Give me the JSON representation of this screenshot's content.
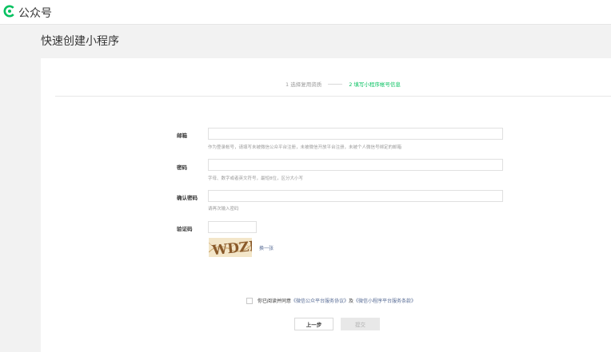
{
  "header": {
    "brand": "公众号",
    "brand_color": "#07c160"
  },
  "page": {
    "title": "快速创建小程序"
  },
  "steps": {
    "step1": "1 选择复用资质",
    "step2": "2 填写小程序帐号信息",
    "active_color": "#07c160"
  },
  "form": {
    "email": {
      "label": "邮箱",
      "value": "",
      "hint": "作为登录帐号，请填写未被微信公众平台注册，未被微信开放平台注册，未被个人微信号绑定的邮箱"
    },
    "password": {
      "label": "密码",
      "value": "",
      "hint": "字母、数字或者英文符号，最短8位，区分大小写"
    },
    "confirm_password": {
      "label": "确认密码",
      "value": "",
      "hint": "请再次输入密码"
    },
    "captcha": {
      "label": "验证码",
      "value": "",
      "image_text": "WDZE",
      "refresh_label": "换一张"
    }
  },
  "agreement": {
    "checked": false,
    "prefix": "你已阅读并同意",
    "link1": "《微信公众平台服务协议》",
    "and": "及",
    "link2": "《微信小程序平台服务条款》"
  },
  "buttons": {
    "prev": "上一步",
    "submit": "提交"
  }
}
